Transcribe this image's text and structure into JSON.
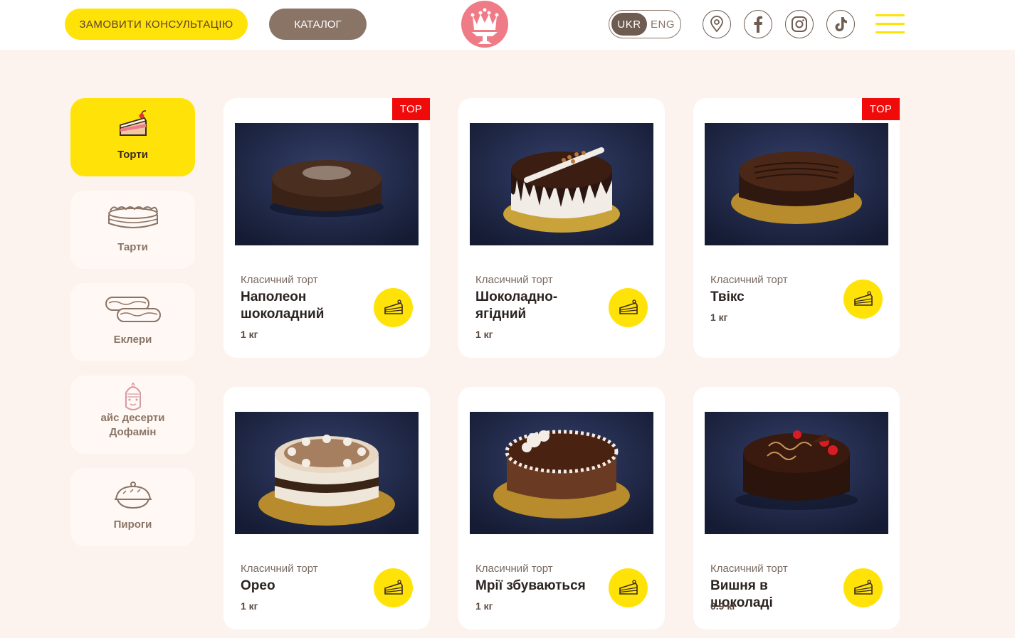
{
  "header": {
    "consult_label": "ЗАМОВИТИ КОНСУЛЬТАЦІЮ",
    "catalog_label": "КАТАЛОГ",
    "lang_active": "UKR",
    "lang_inactive": "ENG",
    "logo_icon": "crown-cake-logo",
    "social": [
      "location-icon",
      "facebook-icon",
      "instagram-icon",
      "tiktok-icon"
    ],
    "menu_icon": "hamburger-menu-icon"
  },
  "sidebar": {
    "items": [
      {
        "label": "Торти",
        "icon": "cake-slice-icon",
        "active": true
      },
      {
        "label": "Тарти",
        "icon": "tart-icon",
        "active": false
      },
      {
        "label": "Еклери",
        "icon": "eclair-icon",
        "active": false
      },
      {
        "label": "айс десерти Дофамін",
        "icon": "ice-dessert-icon",
        "active": false
      },
      {
        "label": "Пироги",
        "icon": "pie-icon",
        "active": false
      }
    ]
  },
  "products": [
    {
      "type": "Класичний торт",
      "name": "Наполеон шоколадний",
      "weight": "1 кг",
      "badge": "TOP"
    },
    {
      "type": "Класичний торт",
      "name": "Шоколадно-ягідний",
      "weight": "1 кг",
      "badge": ""
    },
    {
      "type": "Класичний торт",
      "name": "Твікс",
      "weight": "1 кг",
      "badge": "TOP"
    },
    {
      "type": "Класичний торт",
      "name": "Орео",
      "weight": "1 кг",
      "badge": ""
    },
    {
      "type": "Класичний торт",
      "name": "Мрії збуваються",
      "weight": "1 кг",
      "badge": ""
    },
    {
      "type": "Класичний торт",
      "name": "Вишня в шоколаді",
      "weight": "0.9 кг",
      "badge": ""
    }
  ],
  "colors": {
    "accent_yellow": "#ffe208",
    "brown": "#8a7466",
    "badge_red": "#f00a0a",
    "page_bg": "#fdf3ee"
  }
}
